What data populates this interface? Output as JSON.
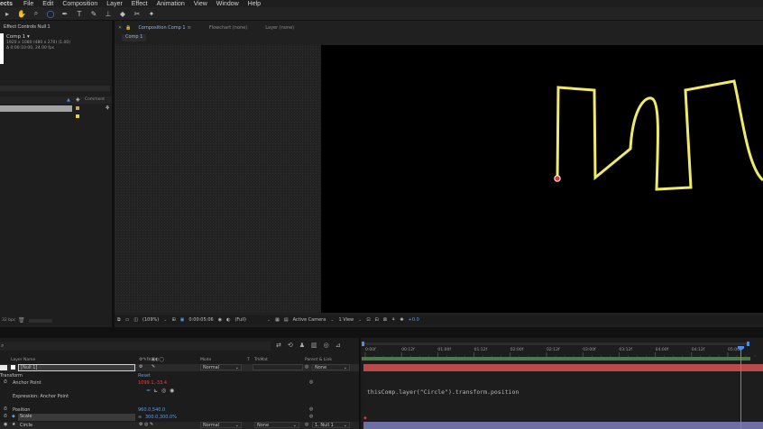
{
  "menu": [
    "ects",
    "File",
    "Edit",
    "Composition",
    "Layer",
    "Effect",
    "Animation",
    "View",
    "Window",
    "Help"
  ],
  "tools": [
    "▸",
    "✋",
    "⌕",
    "◯",
    "✒",
    "T",
    "✎",
    "⊥",
    "◆",
    "✂",
    "✦"
  ],
  "effect_controls": {
    "title": "Effect Controls Null 1",
    "comp_name": "Comp 1 ▾",
    "comp_size": "1920 x 1080 (480 x 270) (1.00)",
    "comp_duration": "Δ 0:00:10:00, 24.00 fps"
  },
  "project": {
    "comment_header": "Comment"
  },
  "comp_panel": {
    "tab_active": "Composition Comp 1",
    "tab_flowchart": "Flowchart (none)",
    "tab_layer": "Layer (none)",
    "breadcrumb": "Comp 1"
  },
  "viewer_controls": {
    "zoom": "(109%)",
    "timecode": "0:00:05:06",
    "resolution": "(Full)",
    "camera": "Active Camera",
    "views": "1 View",
    "exposure": "+0.0"
  },
  "project_footer": {
    "bpc": "32 bpc"
  },
  "timeline": {
    "columns": {
      "layer_name": "Layer Name",
      "mode": "Mode",
      "t": "T",
      "trkmat": "TrkMat",
      "parent": "Parent & Link"
    },
    "layer1": {
      "name": "[Null 1]",
      "mode": "Normal",
      "parent": "None"
    },
    "transform": {
      "label": "Transform",
      "reset": "Reset"
    },
    "anchor_point": {
      "label": "Anchor Point",
      "value": "1099.1,-33.4"
    },
    "expression_label": "Expression: Anchor Point",
    "expression_code": "thisComp.layer(\"Circle\").transform.position",
    "position": {
      "label": "Position",
      "value": "960.0,540.0"
    },
    "scale": {
      "label": "Scale",
      "value": "300.0,300.0%"
    },
    "layer2": {
      "name": "Circle",
      "mode": "Normal",
      "trkmat": "None",
      "parent": "1. Null 1"
    },
    "ruler_labels": [
      "0:00f",
      "00:12f",
      "01:00f",
      "01:12f",
      "02:00f",
      "02:12f",
      "03:00f",
      "03:12f",
      "04:00f",
      "04:12f",
      "05:00f"
    ],
    "playhead_time_fraction": 0.96
  },
  "colors": {
    "accent": "#4b8ef0",
    "stroke": "#f0ea6a",
    "null_bar": "#b84a4a",
    "layer_bar": "#6e6ea6"
  }
}
